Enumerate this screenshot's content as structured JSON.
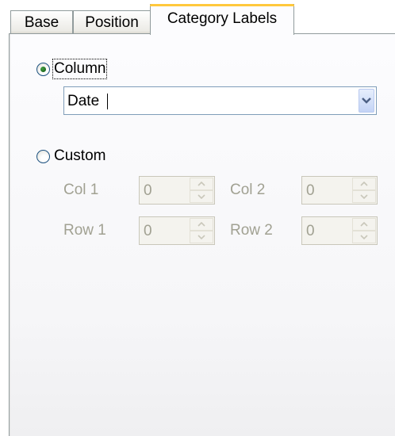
{
  "tabs": [
    {
      "label": "Base"
    },
    {
      "label": "Position"
    },
    {
      "label": "Category Labels"
    }
  ],
  "column_option": {
    "label": "Column",
    "checked": true
  },
  "column_dropdown": {
    "value": "Date"
  },
  "custom_option": {
    "label": "Custom",
    "checked": false
  },
  "fields": {
    "col1": {
      "label": "Col 1",
      "value": "0"
    },
    "col2": {
      "label": "Col 2",
      "value": "0"
    },
    "row1": {
      "label": "Row 1",
      "value": "0"
    },
    "row2": {
      "label": "Row 2",
      "value": "0"
    }
  },
  "colors": {
    "active_tab_accent": "#ffc83c",
    "disabled_text": "#a1a192"
  },
  "icons": {
    "dropdown": "chevron-down-icon",
    "spin_up": "arrow-up-icon",
    "spin_down": "arrow-down-icon"
  }
}
